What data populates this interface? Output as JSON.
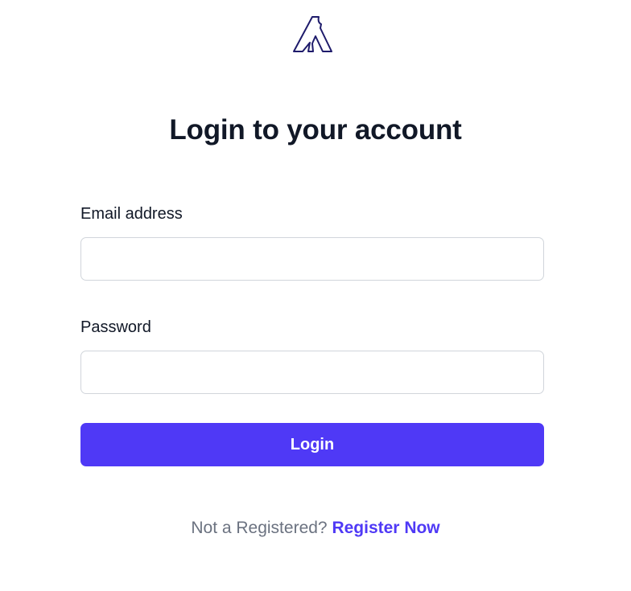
{
  "logo": {
    "icon": "letter-a-logo-icon",
    "color": "#1e1b6b"
  },
  "heading": {
    "title": "Login to your account"
  },
  "form": {
    "email": {
      "label": "Email address",
      "value": "",
      "placeholder": ""
    },
    "password": {
      "label": "Password",
      "value": "",
      "placeholder": ""
    },
    "submit_label": "Login"
  },
  "footer": {
    "prompt": "Not a Registered?",
    "link_label": "Register Now"
  },
  "colors": {
    "accent": "#4f39f6",
    "text": "#111827",
    "muted": "#6b7280",
    "border": "#d1d5db"
  }
}
